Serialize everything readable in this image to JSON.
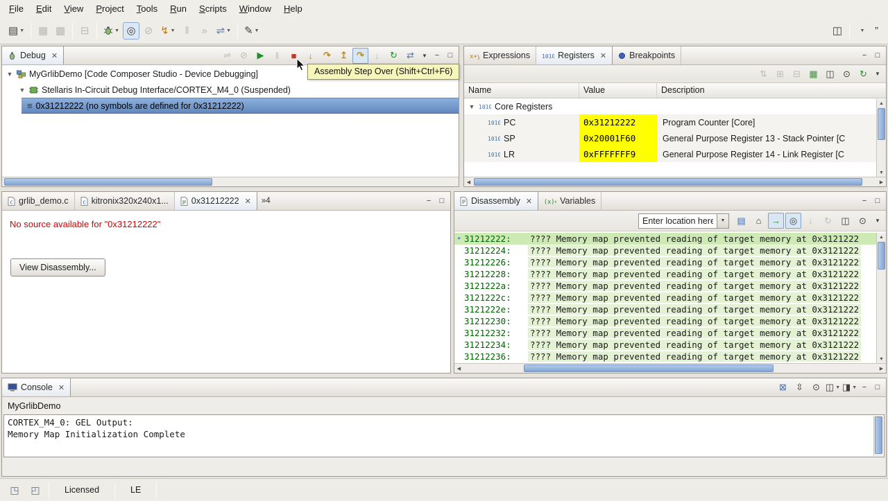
{
  "menu": {
    "items": [
      "File",
      "Edit",
      "View",
      "Project",
      "Tools",
      "Run",
      "Scripts",
      "Window",
      "Help"
    ]
  },
  "tooltip": "Assembly Step Over (Shift+Ctrl+F6)",
  "debug_view": {
    "tab_label": "Debug",
    "session": "MyGrlibDemo [Code Composer Studio - Device Debugging]",
    "thread": "Stellaris In-Circuit Debug Interface/CORTEX_M4_0 (Suspended)",
    "frame": "0x31212222  (no symbols are defined for 0x31212222)"
  },
  "registers_view": {
    "tab_expressions": "Expressions",
    "tab_registers": "Registers",
    "tab_breakpoints": "Breakpoints",
    "col_name": "Name",
    "col_value": "Value",
    "col_description": "Description",
    "group_label": "Core Registers",
    "rows": [
      {
        "name": "PC",
        "value": "0x31212222",
        "description": "Program Counter [Core]"
      },
      {
        "name": "SP",
        "value": "0x20001F60",
        "description": "General Purpose Register 13 - Stack Pointer [C"
      },
      {
        "name": "LR",
        "value": "0xFFFFFFF9",
        "description": "General Purpose Register 14 - Link Register [C"
      }
    ],
    "value_highlight_color": "#FFFF00"
  },
  "editor": {
    "tab1": "grlib_demo.c",
    "tab2": "kitronix320x240x1...",
    "tab3": "0x31212222",
    "tab_overflow": "»4",
    "message": "No source available for \"0x31212222\"",
    "button_label": "View Disassembly..."
  },
  "disassembly_view": {
    "tab_disassembly": "Disassembly",
    "tab_variables": "Variables",
    "location_text": "Enter location here",
    "message": "???? Memory map prevented reading of target memory at 0x3121222",
    "addresses": [
      "31212222:",
      "31212224:",
      "31212226:",
      "31212228:",
      "3121222a:",
      "3121222c:",
      "3121222e:",
      "31212230:",
      "31212232:",
      "31212234:",
      "31212236:"
    ],
    "current_line_color": "#CDE9B4"
  },
  "console_view": {
    "tab_label": "Console",
    "title": "MyGrlibDemo",
    "line1": "CORTEX_M4_0: GEL Output:",
    "line2": "Memory Map Initialization Complete"
  },
  "status_bar": {
    "licensed": "Licensed",
    "endianness": "LE"
  },
  "icons": {
    "registers_bits": "1010"
  }
}
